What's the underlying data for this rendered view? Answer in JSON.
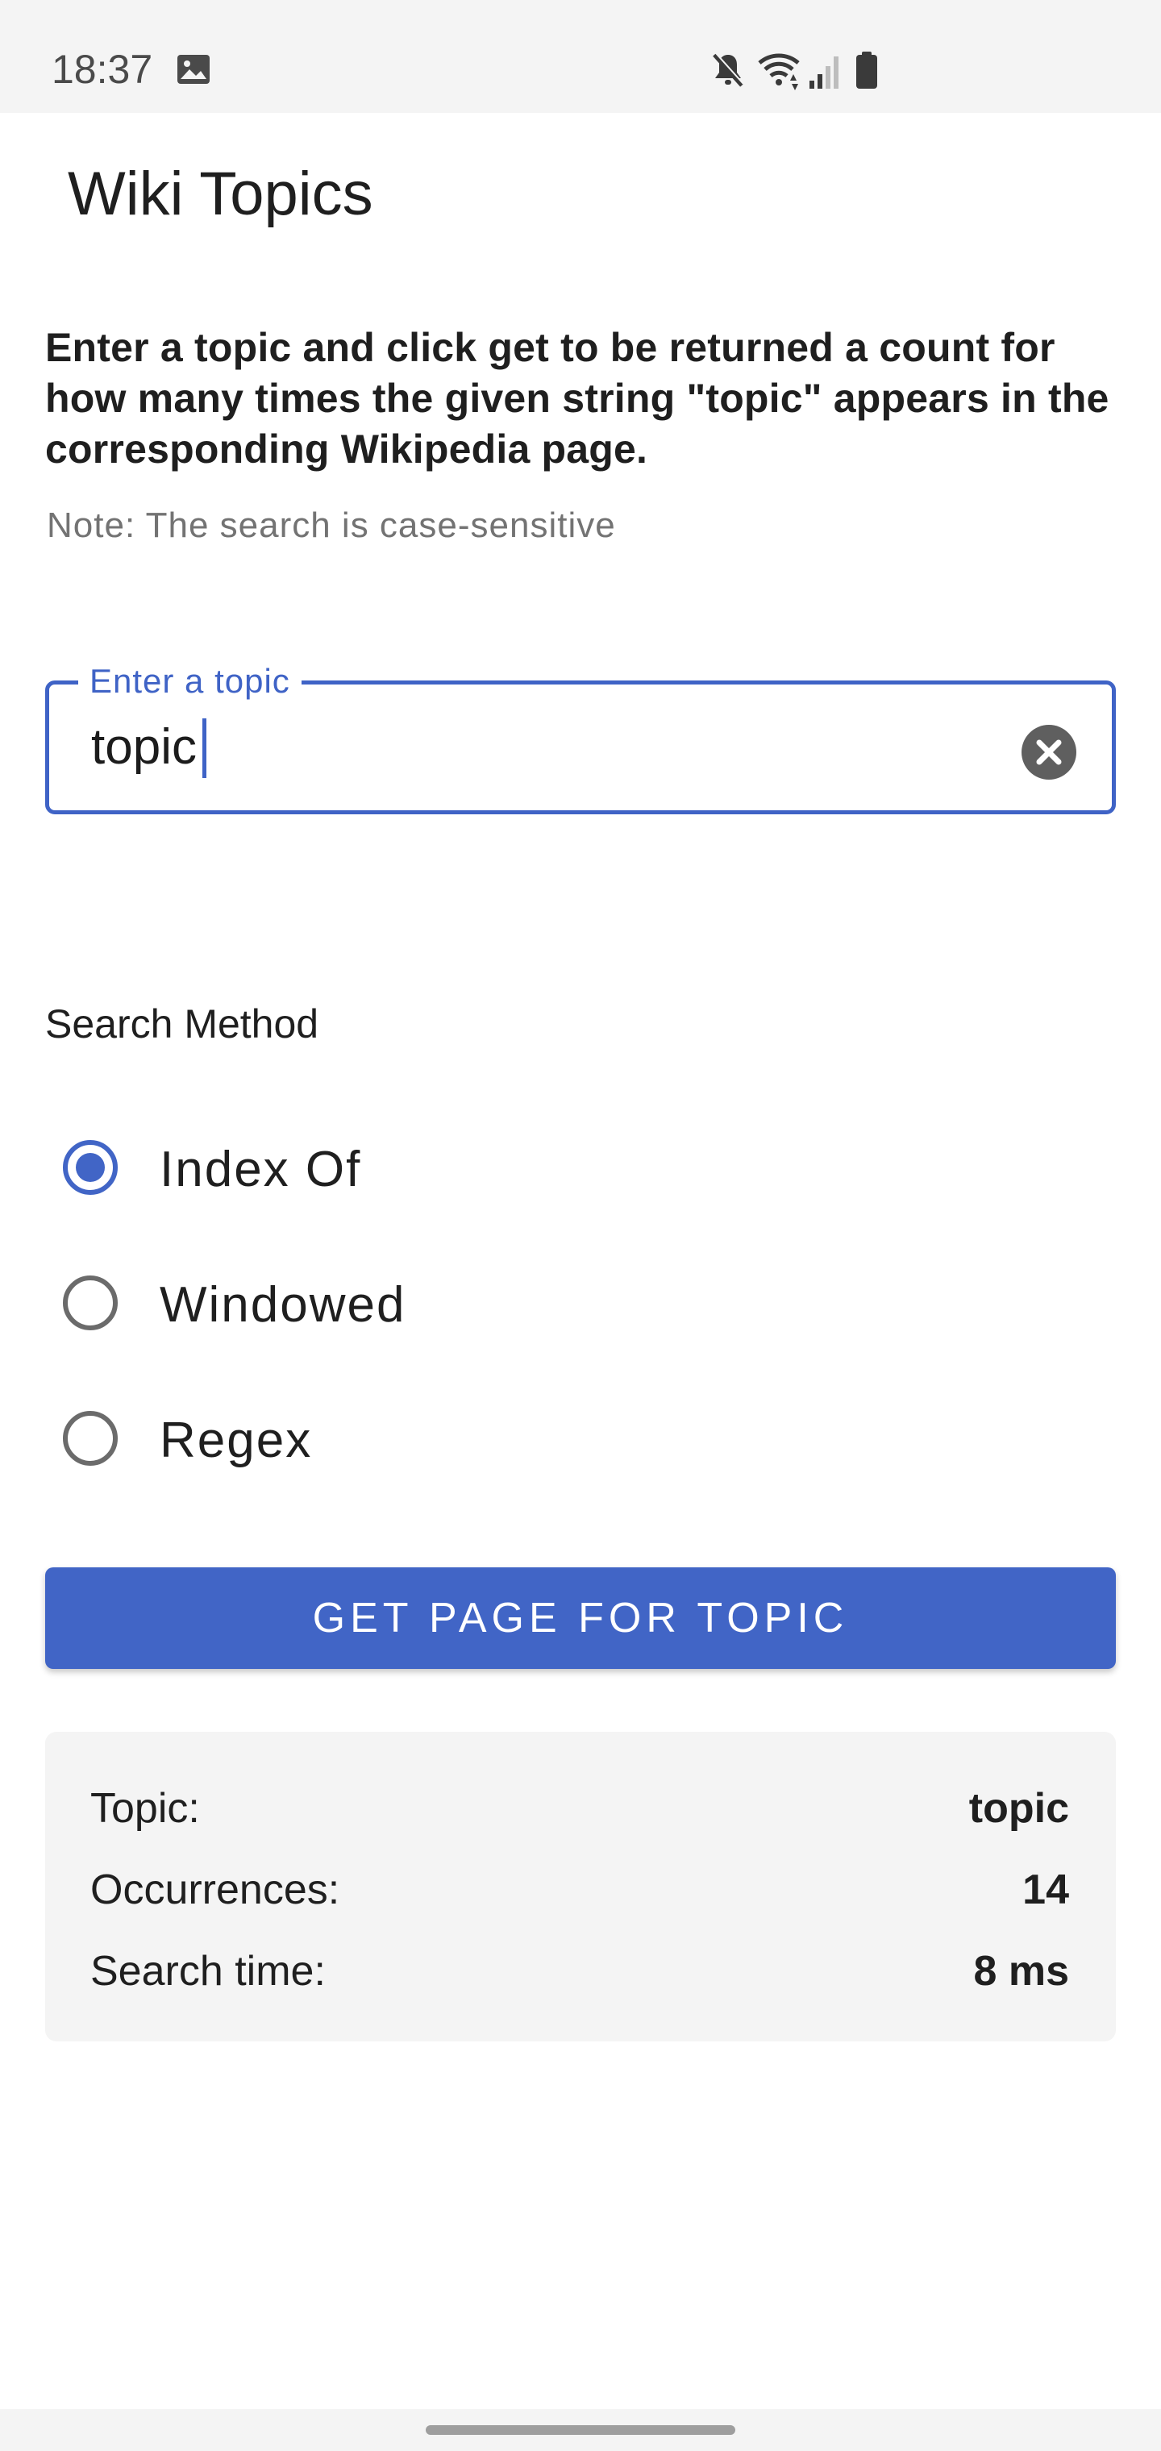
{
  "status_bar": {
    "time": "18:37",
    "icons": [
      "image-icon",
      "mute-icon",
      "wifi-icon",
      "signal-icon",
      "battery-icon"
    ]
  },
  "app": {
    "title": "Wiki Topics"
  },
  "intro": {
    "description": "Enter a topic and click get to be returned a count for how many times the given string \"topic\" appears in the corresponding Wikipedia page.",
    "note": "Note: The search is case-sensitive"
  },
  "topic_field": {
    "label": "Enter a topic",
    "value": "topic",
    "clear_icon": "clear-icon"
  },
  "search_method": {
    "label": "Search Method",
    "options": [
      {
        "label": "Index Of",
        "selected": true
      },
      {
        "label": "Windowed",
        "selected": false
      },
      {
        "label": "Regex",
        "selected": false
      }
    ]
  },
  "action": {
    "button_label": "GET PAGE FOR TOPIC"
  },
  "results": {
    "rows": [
      {
        "key": "Topic:",
        "value": "topic"
      },
      {
        "key": "Occurrences:",
        "value": "14"
      },
      {
        "key": "Search time:",
        "value": "8 ms"
      }
    ]
  },
  "colors": {
    "accent": "#4165c6",
    "card_background": "#f4f4f4",
    "status_bar": "#f4f4f4"
  }
}
